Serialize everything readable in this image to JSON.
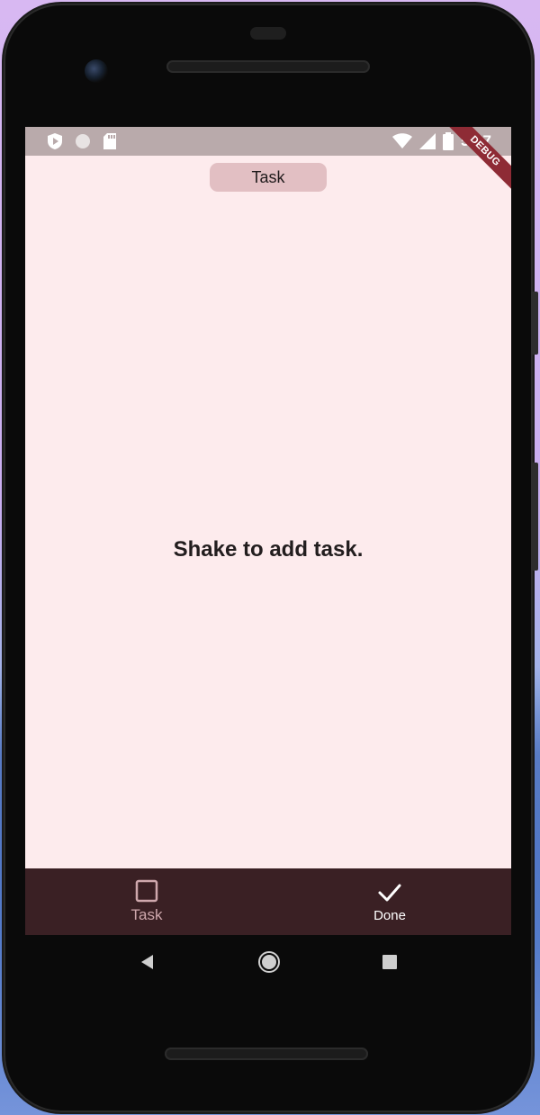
{
  "statusbar": {
    "time": "5:37",
    "icons": [
      "play-protect-icon",
      "circle-icon",
      "sd-card-icon",
      "wifi-icon",
      "signal-icon",
      "battery-icon"
    ]
  },
  "debug_banner": "DEBUG",
  "header": {
    "chip_label": "Task"
  },
  "main": {
    "empty_message": "Shake to add task."
  },
  "bottom_nav": {
    "items": [
      {
        "label": "Task",
        "icon": "checkbox-outline-icon",
        "active": false
      },
      {
        "label": "Done",
        "icon": "check-icon",
        "active": true
      }
    ]
  },
  "android_nav": {
    "buttons": [
      "back-icon",
      "home-icon",
      "recents-icon"
    ]
  },
  "colors": {
    "screen_bg": "#fdebed",
    "statusbar_bg": "#b9aaab",
    "chip_bg": "#e2bfc3",
    "bottom_nav_bg": "#3a2024",
    "inactive_label": "#cfa8ad",
    "debug_ribbon": "#8e2b35"
  }
}
